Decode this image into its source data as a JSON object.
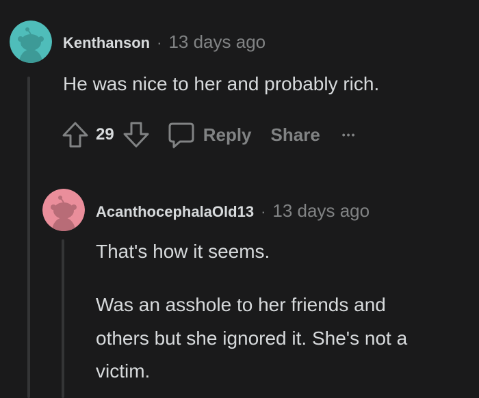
{
  "comment1": {
    "username": "Kenthanson",
    "separator": "·",
    "time": "13 days ago",
    "body": "He was nice to her and probably rich.",
    "score": "29",
    "reply_label": "Reply",
    "share_label": "Share",
    "more_label": "•••",
    "avatar_color": "#4fbdba"
  },
  "comment2": {
    "username": "AcanthocephalaOld13",
    "separator": "·",
    "time": "13 days ago",
    "paragraphs": [
      "That's how it seems.",
      "Was an asshole to her friends and",
      "others but she ignored it. She's not a",
      "victim."
    ],
    "avatar_color": "#ea8e9b"
  }
}
